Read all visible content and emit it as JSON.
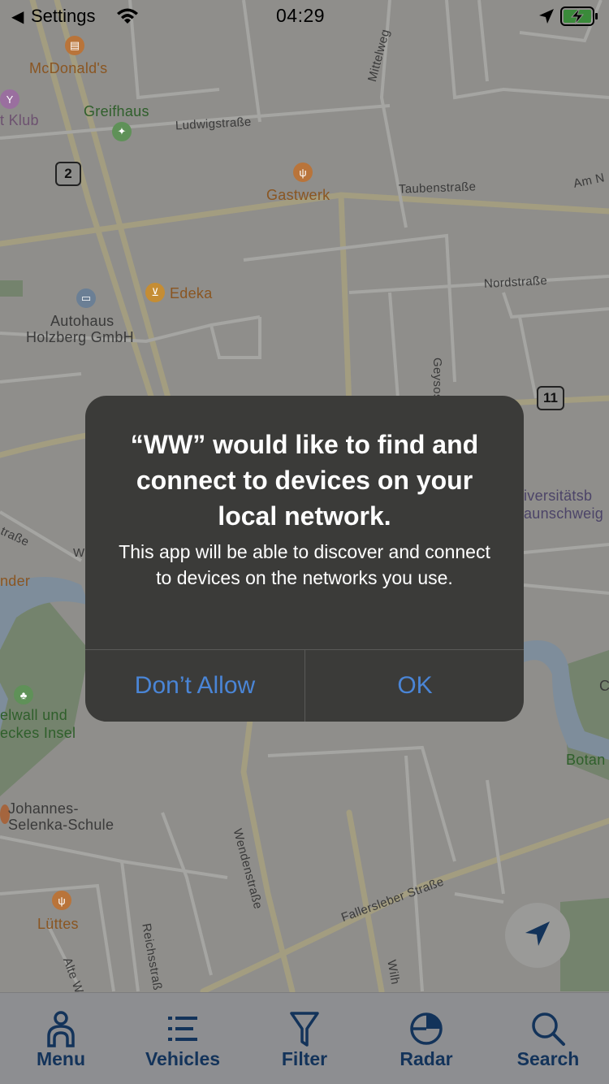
{
  "status_bar": {
    "back_label": "Settings",
    "time": "04:29"
  },
  "map": {
    "pois": {
      "mcdonalds": "McDonald's",
      "klub": "t Klub",
      "greifhaus": "Greifhaus",
      "gastwerk": "Gastwerk",
      "edeka": "Edeka",
      "autohaus_line1": "Autohaus",
      "autohaus_line2": "Holzberg GmbH",
      "universitat_line1": "iversitätsb",
      "universitat_line2": "aunschweig",
      "nder": "nder",
      "ewall_line1": "elwall und",
      "ewall_line2": "eckes Insel",
      "johannes_line1": "Johannes-",
      "johannes_line2": "Selenka-Schule",
      "luttes": "Lüttes",
      "botan": "Botan",
      "c_edge": "C"
    },
    "streets": {
      "ludwigstrasse": "Ludwigstraße",
      "mittelweg": "Mittelweg",
      "taubenstrasse": "Taubenstraße",
      "am_n": "Am N",
      "nordstrasse": "Nordstraße",
      "geysostrasse": "Geysostraße",
      "strasse_left": "traße",
      "w_left": "W",
      "wendenstrasse": "Wendenstraße",
      "fallersleber": "Fallersleber Straße",
      "reichsstrasse": "Reichsstraß",
      "alte_w": "Alte W",
      "wilh": "Wilh"
    },
    "route_shields": {
      "two": "2",
      "eleven": "11"
    }
  },
  "alert": {
    "title": "“WW” would like to find and connect to devices on your local network.",
    "message": "This app will be able to discover and connect to devices on the networks you use.",
    "buttons": {
      "deny": "Don’t Allow",
      "ok": "OK"
    }
  },
  "tab_bar": {
    "tabs": [
      {
        "label": "Menu",
        "icon": "person-icon"
      },
      {
        "label": "Vehicles",
        "icon": "list-icon"
      },
      {
        "label": "Filter",
        "icon": "filter-icon"
      },
      {
        "label": "Radar",
        "icon": "radar-icon"
      },
      {
        "label": "Search",
        "icon": "search-icon"
      }
    ]
  },
  "colors": {
    "alert_button": "#4a85d6",
    "tab_label": "#13335a",
    "overlay_map": "#8f8e8b"
  }
}
